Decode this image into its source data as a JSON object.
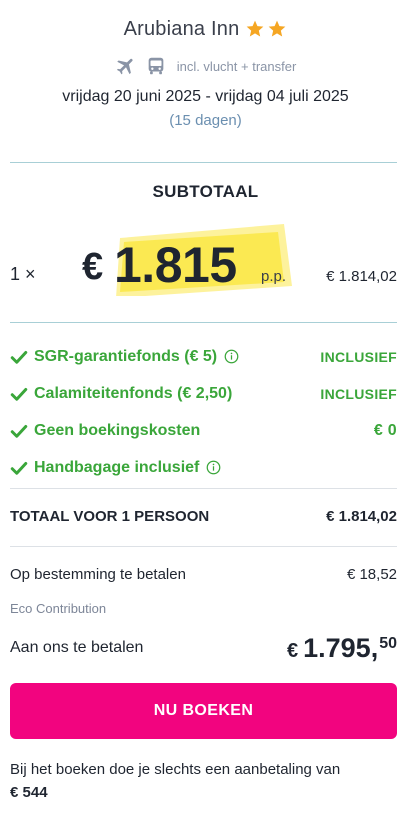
{
  "hotel": {
    "name": "Arubiana Inn",
    "stars": 2,
    "transport_icons": [
      "airplane-icon",
      "bus-icon"
    ],
    "transport_text": "incl. vlucht + transfer",
    "dates": "vrijdag 20 juni 2025 - vrijdag 04 juli 2025",
    "duration": "(15 dagen)"
  },
  "subtotal": {
    "title": "SUBTOTAAL",
    "quantity": "1 ×",
    "currency": "€",
    "price_per_person": "1.815",
    "pp_label": "p.p.",
    "line_total": "€ 1.814,02"
  },
  "inclusions": [
    {
      "label": "SGR-garantiefonds  (€ 5)",
      "has_info": true,
      "value": "INCLUSIEF"
    },
    {
      "label": "Calamiteitenfonds  (€ 2,50)",
      "has_info": false,
      "value": "INCLUSIEF"
    },
    {
      "label": "Geen boekingskosten",
      "has_info": false,
      "value": "€ 0"
    },
    {
      "label": "Handbagage inclusief",
      "has_info": true,
      "value": ""
    }
  ],
  "total": {
    "label": "TOTAAL VOOR 1 PERSOON",
    "value": "€ 1.814,02"
  },
  "destination": {
    "label": "Op bestemming te betalen",
    "value": "€ 18,52",
    "note": "Eco Contribution"
  },
  "pay": {
    "label": "Aan ons te betalen",
    "currency": "€",
    "main": "1.795,",
    "cents": "50"
  },
  "book_button": "NU BOEKEN",
  "footnote": {
    "text": "Bij het boeken doe je slechts een aanbetaling van",
    "deposit": "€ 544"
  },
  "colors": {
    "accent": "#f2047f",
    "success": "#3aa63a",
    "star": "#f5a623",
    "highlight": "#fbe84a"
  }
}
